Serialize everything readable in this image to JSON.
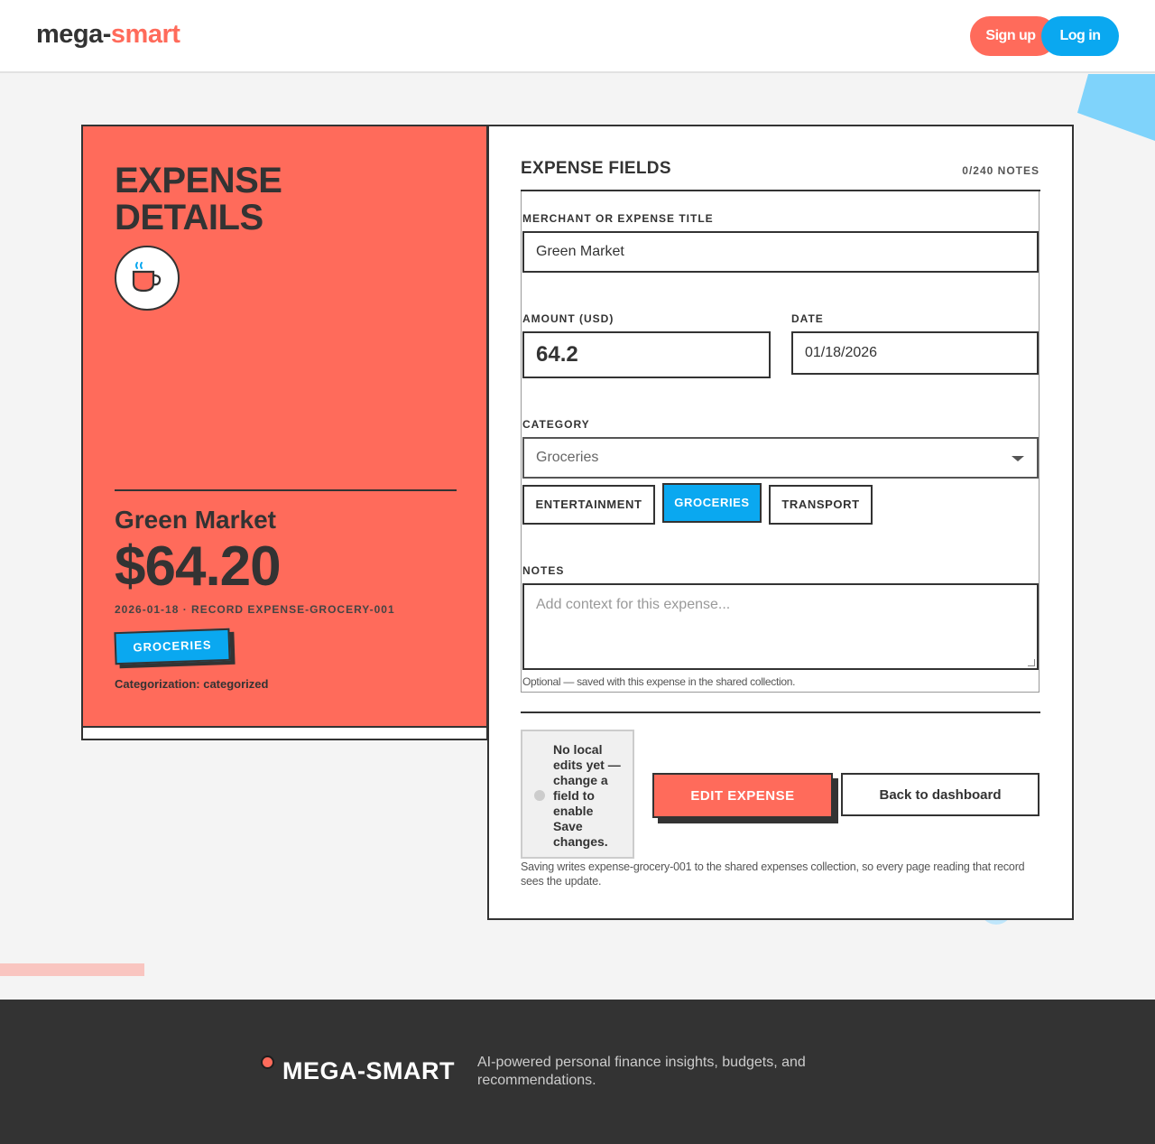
{
  "header": {
    "logo_part1": "mega-",
    "logo_part2": "smart",
    "signup_label": "Sign up",
    "login_label": "Log in"
  },
  "summary": {
    "title_line1": "EXPENSE",
    "title_line2": "DETAILS",
    "icon": "coffee-cup-icon",
    "merchant": "Green Market",
    "amount": "$64.20",
    "meta": "2026-01-18 · RECORD EXPENSE-GROCERY-001",
    "category_badge": "GROCERIES",
    "categorization": "Categorization: categorized"
  },
  "form": {
    "title": "EXPENSE FIELDS",
    "notes_count": "0/240 NOTES",
    "merchant_label": "MERCHANT OR EXPENSE TITLE",
    "merchant_value": "Green Market",
    "amount_label": "AMOUNT (USD)",
    "amount_value": "64.2",
    "date_label": "DATE",
    "date_value": "01/18/2026",
    "category_label": "CATEGORY",
    "category_selected": "Groceries",
    "category_chips": [
      "ENTERTAINMENT",
      "GROCERIES",
      "TRANSPORT"
    ],
    "active_chip": "GROCERIES",
    "notes_label": "NOTES",
    "notes_placeholder": "Add context for this expense...",
    "notes_helper": "Optional — saved with this expense in the shared collection."
  },
  "actions": {
    "status_text": "No local edits yet — change a field to enable Save changes.",
    "edit_label": "EDIT EXPENSE",
    "back_label": "Back to dashboard",
    "save_note": "Saving writes expense-grocery-001 to the shared expenses collection, so every page reading that record sees the update."
  },
  "footer": {
    "brand": "MEGA-SMART",
    "tagline": "AI-powered personal finance insights, budgets, and recommendations."
  },
  "colors": {
    "coral": "#ff6b5b",
    "blue": "#0aa8f0",
    "dark": "#333333"
  }
}
